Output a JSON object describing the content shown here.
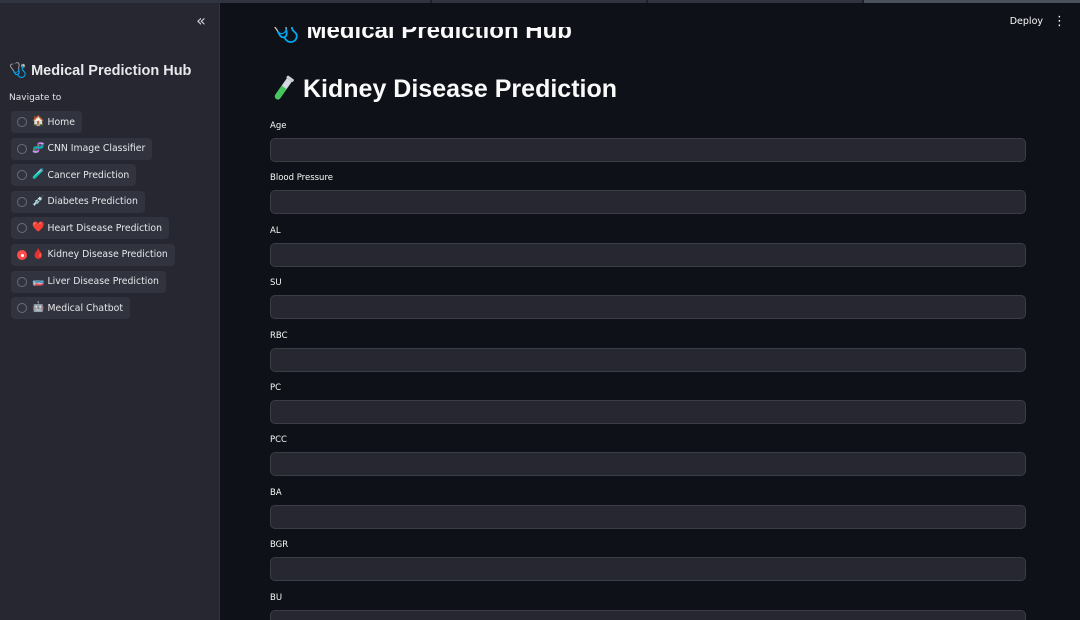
{
  "header": {
    "deploy_label": "Deploy",
    "menu_icon": "more-vertical-icon",
    "ghost_title": "🩺 Medical Prediction Hub"
  },
  "sidebar": {
    "collapse_icon": "double-chevron-left-icon",
    "title": "🩺 Medical Prediction Hub",
    "nav_label": "Navigate to",
    "items": [
      {
        "emoji": "🏠",
        "label": "Home",
        "selected": false
      },
      {
        "emoji": "🧬",
        "label": "CNN Image Classifier",
        "selected": false
      },
      {
        "emoji": "🧪",
        "label": "Cancer Prediction",
        "selected": false
      },
      {
        "emoji": "💉",
        "label": "Diabetes Prediction",
        "selected": false
      },
      {
        "emoji": "❤️",
        "label": "Heart Disease Prediction",
        "selected": false
      },
      {
        "emoji": "🩸",
        "label": "Kidney Disease Prediction",
        "selected": true
      },
      {
        "emoji": "🧫",
        "label": "Liver Disease Prediction",
        "selected": false
      },
      {
        "emoji": "🤖",
        "label": "Medical Chatbot",
        "selected": false
      }
    ]
  },
  "main": {
    "title_icon": "test-tube-icon",
    "title": "Kidney Disease Prediction",
    "fields": [
      {
        "label": "Age",
        "value": ""
      },
      {
        "label": "Blood Pressure",
        "value": ""
      },
      {
        "label": "AL",
        "value": ""
      },
      {
        "label": "SU",
        "value": ""
      },
      {
        "label": "RBC",
        "value": ""
      },
      {
        "label": "PC",
        "value": ""
      },
      {
        "label": "PCC",
        "value": ""
      },
      {
        "label": "BA",
        "value": ""
      },
      {
        "label": "BGR",
        "value": ""
      },
      {
        "label": "BU",
        "value": ""
      }
    ]
  },
  "colors": {
    "background": "#0e1117",
    "sidebar": "#262730",
    "accent": "#ff4b4b",
    "input_bg": "#262730"
  }
}
